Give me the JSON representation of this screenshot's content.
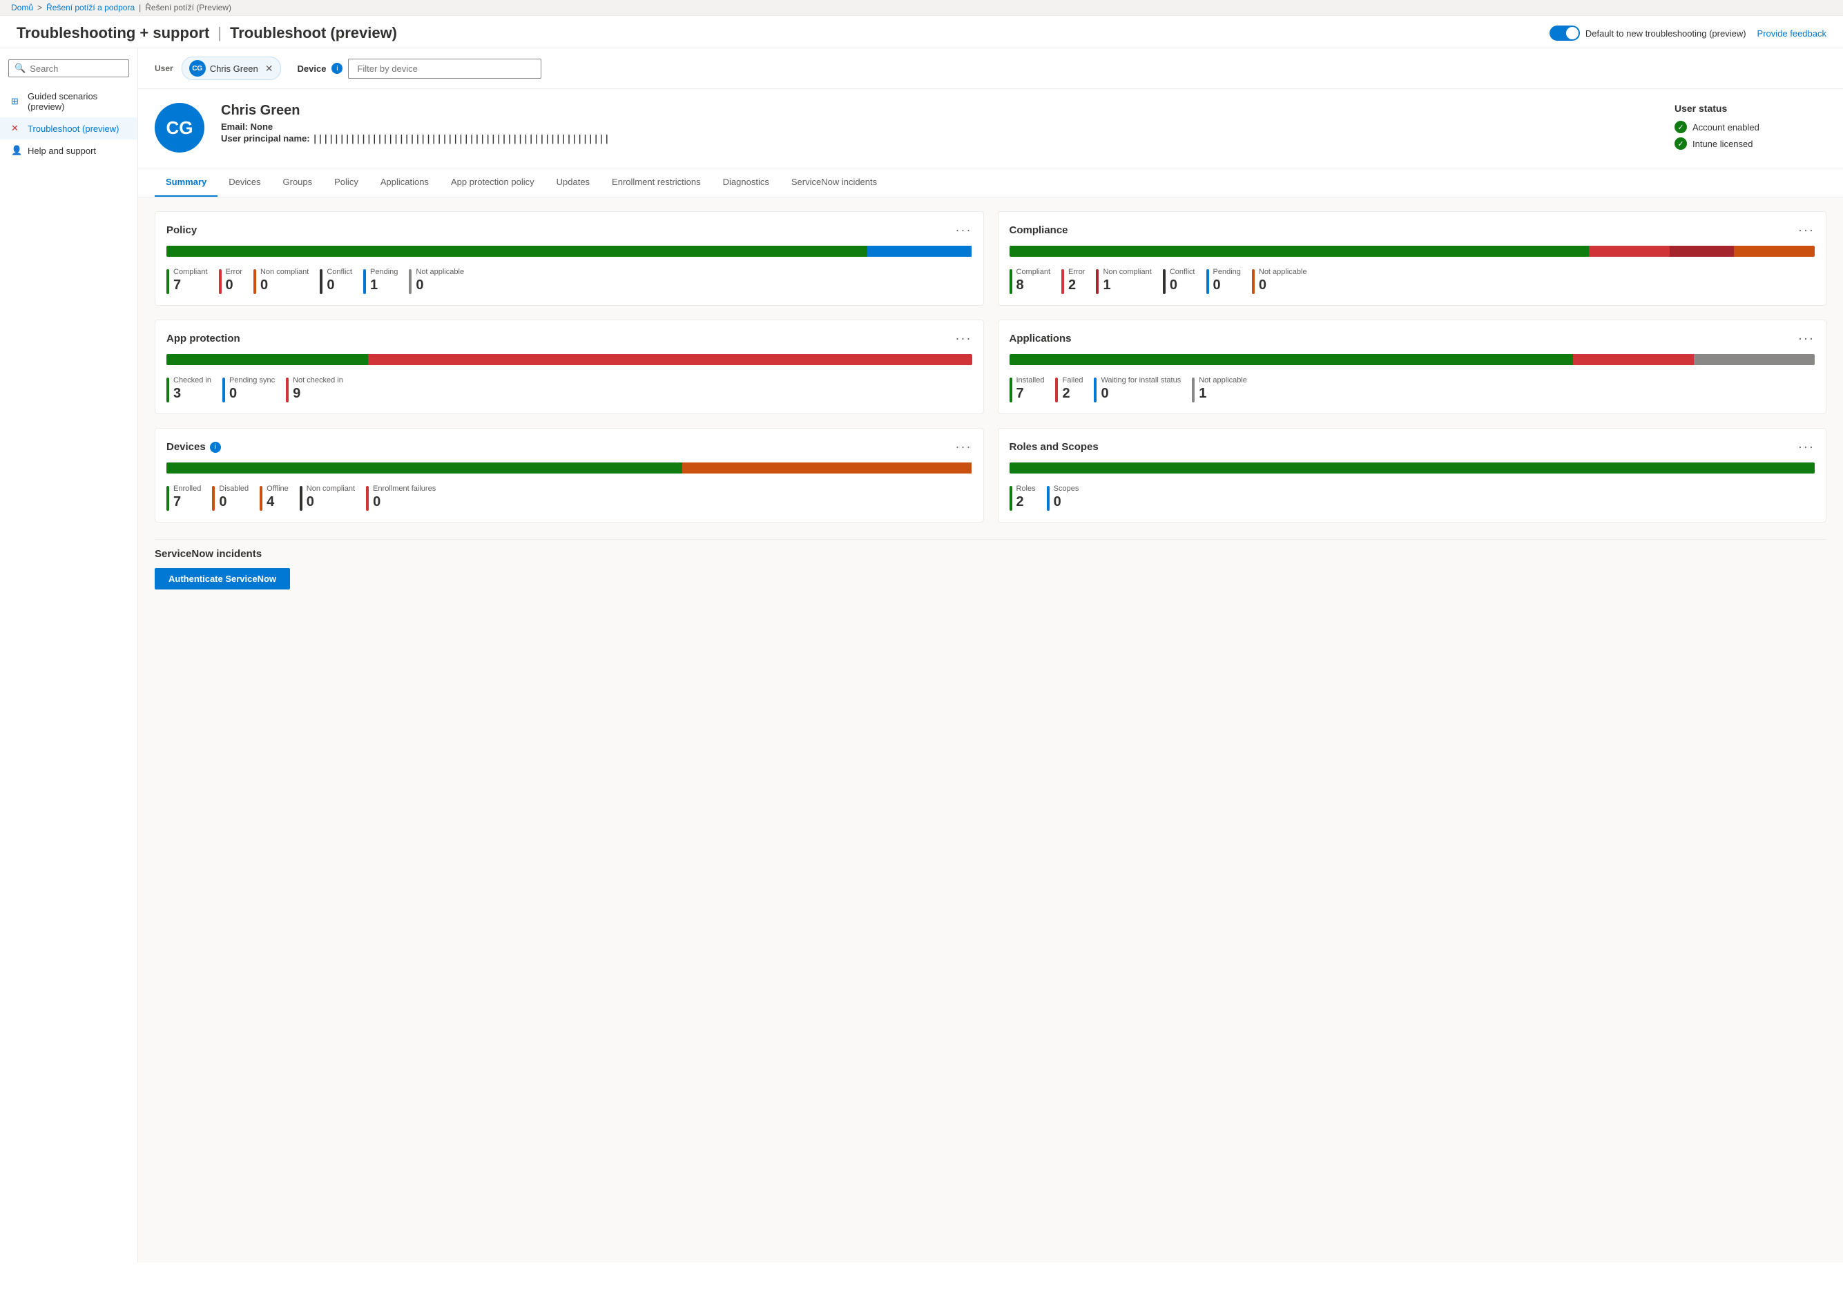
{
  "breadcrumb": {
    "home": "Domů",
    "separator1": ">",
    "level1": "Řešení potíží a podpora",
    "separator2": "|",
    "level2": "Řešení potíží (Preview)"
  },
  "page_title": "Troubleshooting + support",
  "page_subtitle": "Troubleshoot (preview)",
  "toggle": {
    "label": "Default to new troubleshooting (preview)"
  },
  "feedback_link": "Provide feedback",
  "sidebar": {
    "search_placeholder": "Search",
    "items": [
      {
        "id": "guided-scenarios",
        "label": "Guided scenarios (preview)",
        "icon": "grid-icon"
      },
      {
        "id": "troubleshoot",
        "label": "Troubleshoot (preview)",
        "icon": "x-icon",
        "active": true
      },
      {
        "id": "help-support",
        "label": "Help and support",
        "icon": "person-icon"
      }
    ]
  },
  "user_bar": {
    "user_label": "User",
    "user_name": "Chris Green",
    "user_initials": "CG",
    "device_label": "Device",
    "device_placeholder": "Filter by device",
    "device_info": "i"
  },
  "user_profile": {
    "initials": "CG",
    "name": "Chris Green",
    "email_label": "Email:",
    "email_value": "None",
    "upn_label": "User principal name:",
    "upn_value": "|||||||||||||||||||||||||||||||||||||||||||||||||||||||"
  },
  "user_status": {
    "title": "User status",
    "items": [
      {
        "label": "Account enabled",
        "status": "ok"
      },
      {
        "label": "Intune licensed",
        "status": "ok"
      }
    ]
  },
  "tabs": [
    {
      "id": "summary",
      "label": "Summary",
      "active": true
    },
    {
      "id": "devices",
      "label": "Devices"
    },
    {
      "id": "groups",
      "label": "Groups"
    },
    {
      "id": "policy",
      "label": "Policy"
    },
    {
      "id": "applications",
      "label": "Applications"
    },
    {
      "id": "app-protection-policy",
      "label": "App protection policy"
    },
    {
      "id": "updates",
      "label": "Updates"
    },
    {
      "id": "enrollment-restrictions",
      "label": "Enrollment restrictions"
    },
    {
      "id": "diagnostics",
      "label": "Diagnostics"
    },
    {
      "id": "servicenow-incidents",
      "label": "ServiceNow incidents"
    }
  ],
  "cards": {
    "policy": {
      "title": "Policy",
      "bar": [
        {
          "label": "Compliant",
          "value": 7,
          "color": "#107c10",
          "pct": 87
        },
        {
          "label": "Error",
          "value": 0,
          "color": "#d13438",
          "pct": 0
        },
        {
          "label": "Non compliant",
          "value": 0,
          "color": "#ca5010",
          "pct": 0
        },
        {
          "label": "Conflict",
          "value": 0,
          "color": "#323130",
          "pct": 0
        },
        {
          "label": "Pending",
          "value": 1,
          "color": "#0078d4",
          "pct": 13
        },
        {
          "label": "Not applicable",
          "value": 0,
          "color": "#8a8886",
          "pct": 0
        }
      ]
    },
    "compliance": {
      "title": "Compliance",
      "bar": [
        {
          "label": "Compliant",
          "value": 8,
          "color": "#107c10",
          "pct": 72
        },
        {
          "label": "Error",
          "value": 2,
          "color": "#d13438",
          "pct": 10
        },
        {
          "label": "Non compliant",
          "value": 1,
          "color": "#a4262c",
          "pct": 8
        },
        {
          "label": "Conflict",
          "value": 0,
          "color": "#323130",
          "pct": 0
        },
        {
          "label": "Pending",
          "value": 0,
          "color": "#0078d4",
          "pct": 0
        },
        {
          "label": "Not applicable",
          "value": 0,
          "color": "#8a8886",
          "pct": 10
        }
      ]
    },
    "app_protection": {
      "title": "App protection",
      "bar": [
        {
          "label": "Checked in",
          "value": 3,
          "color": "#107c10",
          "pct": 25
        },
        {
          "label": "Pending sync",
          "value": 0,
          "color": "#0078d4",
          "pct": 0
        },
        {
          "label": "Not checked in",
          "value": 9,
          "color": "#d13438",
          "pct": 75
        }
      ]
    },
    "applications": {
      "title": "Applications",
      "bar": [
        {
          "label": "Installed",
          "value": 7,
          "color": "#107c10",
          "pct": 70
        },
        {
          "label": "Failed",
          "value": 2,
          "color": "#d13438",
          "pct": 15
        },
        {
          "label": "Waiting for install status",
          "value": 0,
          "color": "#0078d4",
          "pct": 0
        },
        {
          "label": "Not applicable",
          "value": 1,
          "color": "#8a8886",
          "pct": 15
        }
      ]
    },
    "devices": {
      "title": "Devices",
      "has_info": true,
      "bar": [
        {
          "label": "Enrolled",
          "value": 7,
          "color": "#107c10",
          "pct": 64
        },
        {
          "label": "Disabled",
          "value": 0,
          "color": "#ca5010",
          "pct": 0
        },
        {
          "label": "Offline",
          "value": 4,
          "color": "#ca5010",
          "pct": 36
        },
        {
          "label": "Non compliant",
          "value": 0,
          "color": "#323130",
          "pct": 0
        },
        {
          "label": "Enrollment failures",
          "value": 0,
          "color": "#d13438",
          "pct": 0
        }
      ]
    },
    "roles_scopes": {
      "title": "Roles and Scopes",
      "bar": [
        {
          "label": "Roles",
          "value": 2,
          "color": "#107c10",
          "pct": 100
        },
        {
          "label": "Scopes",
          "value": 0,
          "color": "#0078d4",
          "pct": 0
        }
      ]
    }
  },
  "servicenow": {
    "title": "ServiceNow incidents",
    "button_label": "Authenticate ServiceNow"
  }
}
